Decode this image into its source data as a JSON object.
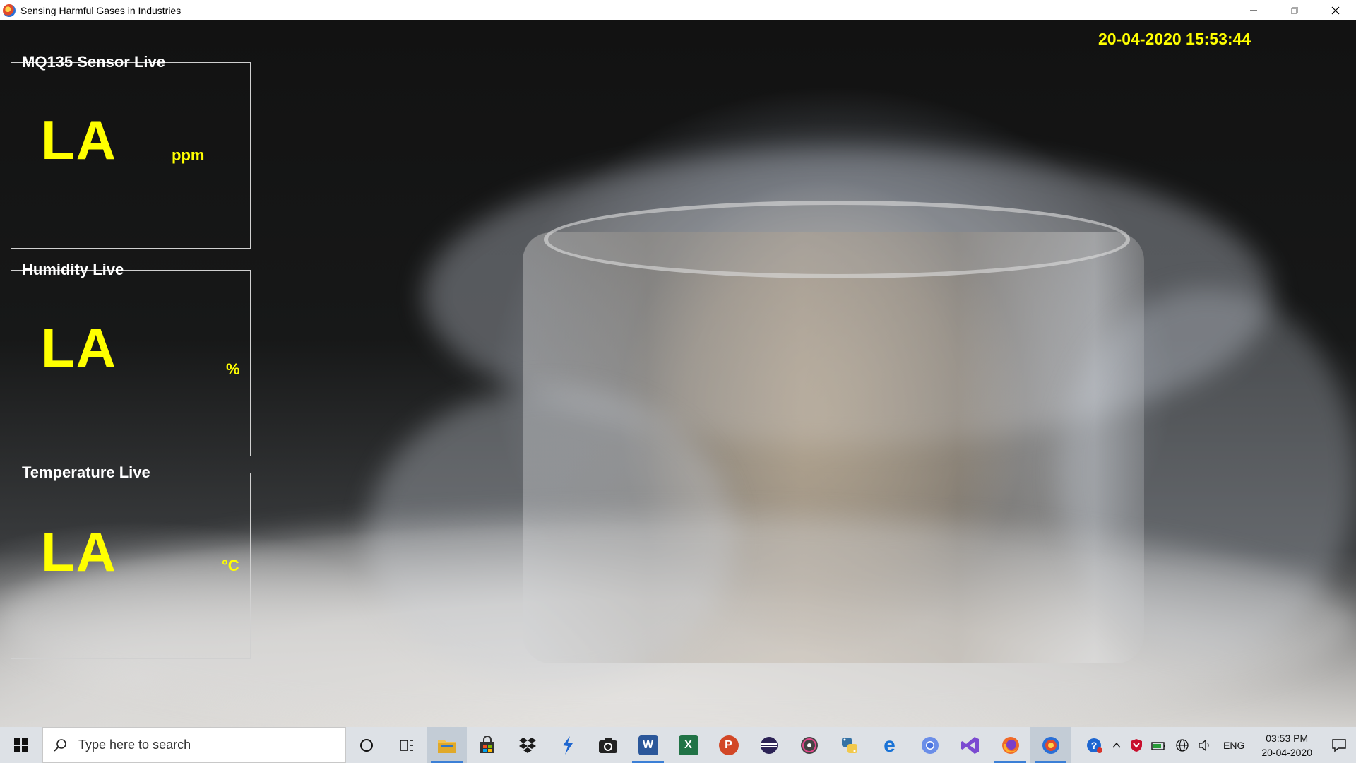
{
  "window": {
    "title": "Sensing Harmful Gases in Industries",
    "controls": [
      "minimize",
      "restore",
      "close"
    ]
  },
  "datetime": "20-04-2020 15:53:44",
  "sensors": [
    {
      "title": "MQ135 Sensor Live",
      "value": "LA",
      "unit": "ppm"
    },
    {
      "title": "Humidity Live",
      "value": "LA",
      "unit": "%"
    },
    {
      "title": "Temperature Live",
      "value": "LA",
      "unit": "°C"
    }
  ],
  "taskbar": {
    "search_placeholder": "Type here to search",
    "apps": [
      {
        "icon": "cortana-icon"
      },
      {
        "icon": "task-view-icon"
      },
      {
        "icon": "file-explorer-icon"
      },
      {
        "icon": "store-icon"
      },
      {
        "icon": "dropbox-icon"
      },
      {
        "icon": "arrow-app-icon"
      },
      {
        "icon": "camera-icon"
      },
      {
        "icon": "word-icon",
        "text": "W"
      },
      {
        "icon": "excel-icon",
        "text": "X"
      },
      {
        "icon": "powerpoint-icon",
        "text": "P"
      },
      {
        "icon": "eclipse-icon"
      },
      {
        "icon": "media-player-icon"
      },
      {
        "icon": "python-icon"
      },
      {
        "icon": "edge-icon",
        "text": "e"
      },
      {
        "icon": "chrome-icon"
      },
      {
        "icon": "visual-studio-icon"
      },
      {
        "icon": "firefox-icon"
      },
      {
        "icon": "sensor-app-icon"
      }
    ],
    "tray": {
      "language": "ENG",
      "time": "03:53 PM",
      "date": "20-04-2020"
    }
  },
  "colors": {
    "accent_text": "#ffff00",
    "label_text": "#ffffff",
    "taskbar_bg": "#dde1e6"
  }
}
